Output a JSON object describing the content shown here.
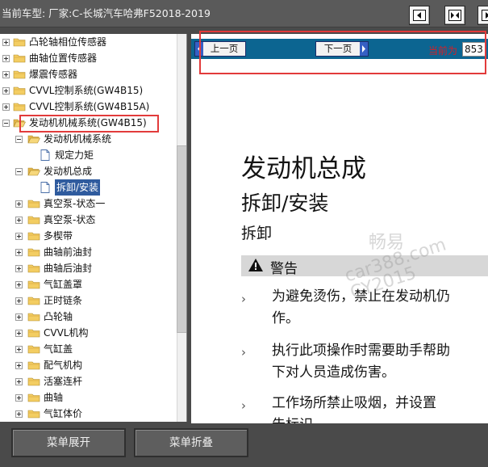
{
  "header": {
    "title": "当前车型:  厂家:C-长城汽车哈弗F52018-2019"
  },
  "toolbar": {
    "buttons": [
      "collapse-left-icon",
      "expand-both-icon",
      "collapse-right-icon"
    ]
  },
  "tree": {
    "items": [
      {
        "label": "凸轮轴相位传感器",
        "level": 0,
        "expanded": false
      },
      {
        "label": "曲轴位置传感器",
        "level": 0,
        "expanded": false
      },
      {
        "label": "爆震传感器",
        "level": 0,
        "expanded": false
      },
      {
        "label": "CVVL控制系统(GW4B15)",
        "level": 0,
        "expanded": false
      },
      {
        "label": "CVVL控制系统(GW4B15A)",
        "level": 0,
        "expanded": false
      },
      {
        "label": "发动机机械系统(GW4B15)",
        "level": 0,
        "expanded": true
      },
      {
        "label": "发动机机械系统",
        "level": 1,
        "expanded": true
      },
      {
        "label": "规定力矩",
        "level": 2,
        "doc": true
      },
      {
        "label": "发动机总成",
        "level": 1,
        "expanded": true
      },
      {
        "label": "拆卸/安装",
        "level": 2,
        "doc": true,
        "selected": true
      },
      {
        "label": "真空泵-状态一",
        "level": 1,
        "expanded": false
      },
      {
        "label": "真空泵-状态",
        "level": 1,
        "expanded": false
      },
      {
        "label": "多楔带",
        "level": 1,
        "expanded": false
      },
      {
        "label": "曲轴前油封",
        "level": 1,
        "expanded": false
      },
      {
        "label": "曲轴后油封",
        "level": 1,
        "expanded": false
      },
      {
        "label": "气缸盖罩",
        "level": 1,
        "expanded": false
      },
      {
        "label": "正时链条",
        "level": 1,
        "expanded": false
      },
      {
        "label": "凸轮轴",
        "level": 1,
        "expanded": false
      },
      {
        "label": "CVVL机构",
        "level": 1,
        "expanded": false
      },
      {
        "label": "气缸盖",
        "level": 1,
        "expanded": false
      },
      {
        "label": "配气机构",
        "level": 1,
        "expanded": false
      },
      {
        "label": "活塞连杆",
        "level": 1,
        "expanded": false
      },
      {
        "label": "曲轴",
        "level": 1,
        "expanded": false
      },
      {
        "label": "气缸体价",
        "level": 1,
        "expanded": false
      }
    ]
  },
  "nav": {
    "prev_label": "上一页",
    "next_label": "下一页",
    "current_label": "当前为",
    "current_page": "853"
  },
  "document": {
    "title": "发动机总成",
    "subtitle": "拆卸/安装",
    "section": "拆卸",
    "warning_title": "警告",
    "paragraphs": [
      [
        "为避免烫伤，禁止在发动机仍",
        "作。"
      ],
      [
        "执行此项操作时需要助手帮助",
        "下对人员造成伤害。"
      ],
      [
        "工作场所禁止吸烟，并设置",
        "告标识"
      ]
    ]
  },
  "watermark": {
    "lines": [
      "畅易",
      "car388.com",
      "CY2015"
    ]
  },
  "bottom": {
    "expand_label": "菜单展开",
    "collapse_label": "菜单折叠"
  },
  "colors": {
    "nav_bar": "#0c6591",
    "highlight_red": "#e23b3b",
    "selected_bg": "#2f5b9e"
  }
}
